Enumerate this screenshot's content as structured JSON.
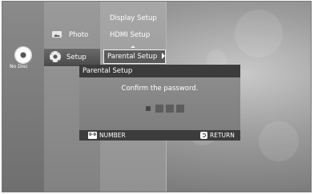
{
  "status": {
    "disc": "No Disc"
  },
  "main_menu": {
    "items": [
      {
        "label": "Photo",
        "icon": "photo-icon"
      },
      {
        "label": "Setup",
        "icon": "gear-icon",
        "selected": true
      }
    ]
  },
  "setup_menu": {
    "items": [
      {
        "label": "Display Setup"
      },
      {
        "label": "HDMI Setup"
      },
      {
        "label": "Parental Setup",
        "selected": true
      }
    ]
  },
  "dialog": {
    "title": "Parental Setup",
    "message": "Confirm the password.",
    "password_length": 4,
    "footer": {
      "number_icon_text": "0-9",
      "number_label": "NUMBER",
      "return_label": "RETURN"
    }
  },
  "colors": {
    "panel_dark": "#3c3c3c",
    "panel_body": "#8a8a8a",
    "text": "#ffffff"
  }
}
